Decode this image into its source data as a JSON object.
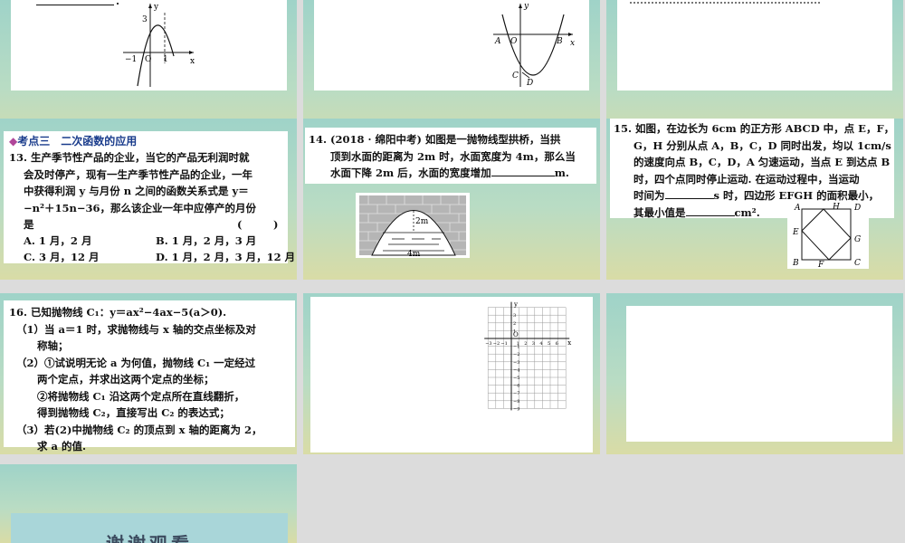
{
  "slide1": {
    "graph": {
      "y_axis": "y",
      "x_axis": "x",
      "tick_3": "3",
      "tick_neg1": "−1",
      "origin": "O",
      "tick_1": "1"
    }
  },
  "slide2": {
    "graph": {
      "y_axis": "y",
      "x_axis": "x",
      "origin": "O",
      "point_a": "A",
      "point_b": "B",
      "point_c": "C",
      "point_d": "D"
    }
  },
  "slide4": {
    "section_marker": "◆",
    "section_title": "考点三　二次函数的应用",
    "lines": [
      "13. 生产季节性产品的企业，当它的产品无利润时就",
      "会及时停产，现有一生产季节性产品的企业，一年",
      "中获得利润 y 与月份 n 之间的函数关系式是 y＝",
      "−n²＋15n−36，那么该企业一年中应停产的月份",
      "是"
    ],
    "paren": "(　　　)",
    "option_a": "A. 1 月，2 月",
    "option_b": "B. 1 月，2 月，3 月",
    "option_c": "C. 3 月，12 月",
    "option_d": "D. 1 月，2 月，3 月，12 月"
  },
  "slide5": {
    "lines": [
      "14. (2018 · 绵阳中考) 如图是一抛物线型拱桥，当拱",
      "顶到水面的距离为 2m 时，水面宽度为 4m，那么当"
    ],
    "line3_prefix": "水面下降 2m 后，水面的宽度增加",
    "line3_suffix": "m.",
    "fig_label_height": "2m",
    "fig_label_width": "4m"
  },
  "slide6": {
    "lines": [
      "15. 如图，在边长为 6cm 的正方形 ABCD 中，点 E，F，",
      "G，H 分别从点 A，B，C，D 同时出发，均以 1cm/s",
      "的速度向点 B，C，D，A 匀速运动，当点 E 到达点 B",
      "时，四个点同时停止运动. 在运动过程中，当运动"
    ],
    "line5_prefix": "时间为",
    "line5_suffix": "s 时，四边形 EFGH 的面积最小，",
    "line6_prefix": "其最小值是",
    "line6_suffix": "cm².",
    "fig": {
      "a": "A",
      "h": "H",
      "d": "D",
      "e": "E",
      "g": "G",
      "b": "B",
      "f": "F",
      "c": "C"
    }
  },
  "slide7": {
    "lines": [
      "16. 已知抛物线 C₁：y＝ax²−4ax−5(a＞0).",
      "（1）当 a＝1 时，求抛物线与 x 轴的交点坐标及对",
      "　　称轴；",
      "（2）①试说明无论 a 为何值，抛物线 C₁ 一定经过",
      "　　两个定点，并求出这两个定点的坐标；",
      "　　②将抛物线 C₁ 沿这两个定点所在直线翻折，",
      "　　得到抛物线 C₂，直接写出 C₂ 的表达式；",
      "（3）若(2)中抛物线 C₂ 的顶点到 x 轴的距离为 2，",
      "　　求 a 的值."
    ]
  },
  "slide8": {
    "grid": {
      "y_axis": "y",
      "x_axis": "x",
      "origin": "O",
      "x_ticks": [
        "−3",
        "−2",
        "−1",
        "1",
        "2",
        "3",
        "4",
        "5",
        "6"
      ],
      "y_ticks": [
        "3",
        "2",
        "1",
        "−1",
        "−2",
        "−3",
        "−4",
        "−5",
        "−6",
        "−7",
        "−8",
        "−9"
      ]
    }
  },
  "slide10": {
    "thanks": "谢谢观看"
  }
}
